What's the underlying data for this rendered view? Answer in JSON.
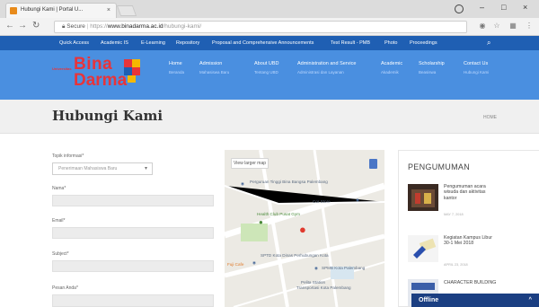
{
  "browser": {
    "tab_title": "Hubungi Kami | Portal U...",
    "tab_close": "×",
    "url_secure": "Secure",
    "url_scheme": "https://",
    "url_host": "www.binadarma.ac.id",
    "url_path": "/hubungi-kami/",
    "window_minimize": "–",
    "window_maximize": "□",
    "window_close": "×"
  },
  "topnav": {
    "items": [
      "Quick Access",
      "Academic IS",
      "E-Learning",
      "Repository",
      "Proposal and Comprehensive Announcements",
      "Test Result - PMB",
      "Photo",
      "Proceedings"
    ]
  },
  "logo": {
    "university": "Universitas",
    "bina": "Bina",
    "darma": "Darma"
  },
  "mainnav": {
    "items": [
      {
        "label": "Home",
        "sub": "Beranda"
      },
      {
        "label": "Admission",
        "sub": "Mahasiswa Baru"
      },
      {
        "label": "About UBD",
        "sub": "Tentang UBD"
      },
      {
        "label": "Administration and Service",
        "sub": "Administrasi dan Layanan"
      },
      {
        "label": "Academic",
        "sub": "Akademik"
      },
      {
        "label": "Scholarship",
        "sub": "Beasiswa"
      },
      {
        "label": "Contact Us",
        "sub": "Hubungi Kami"
      }
    ]
  },
  "page": {
    "title": "Hubungi Kami",
    "breadcrumb": "HOME"
  },
  "form": {
    "topic_label": "Topik informasi*",
    "topic_value": "Penerimaan Mahasiswa Baru",
    "name_label": "Nama*",
    "email_label": "Email*",
    "subject_label": "Subject*",
    "message_label": "Pesan Anda*"
  },
  "map": {
    "view_larger": "View larger map",
    "labels": [
      "Perguruan Tinggi Bina Bangsa Palembang",
      "Cor Store",
      "Health Club Pusat Gym",
      "Fuji Cafe",
      "SPTD Kota Dinas Perhubungan Kota",
      "SPMB Kota Palembang",
      "Pelita Station",
      "Transportasi Kota Palembang"
    ]
  },
  "sidebar": {
    "title": "PENGUMUMAN",
    "news": [
      {
        "text": "Pengumuman acara wisuda dan aktivitas kantor",
        "date": "MAY 7, 2018"
      },
      {
        "text": "Kegiatan Kampus Libur 30-1 Mei 2018",
        "date": "APRIL 23, 2018"
      },
      {
        "text": "CHARACTER BUILDING",
        "date": ""
      }
    ]
  },
  "chat": {
    "status": "Offline",
    "chevron": "^"
  },
  "colors": {
    "topnav": "#1f5fb3",
    "header": "#4a8fe0",
    "logo_red": "#e8343a",
    "chat": "#1b3f82"
  }
}
